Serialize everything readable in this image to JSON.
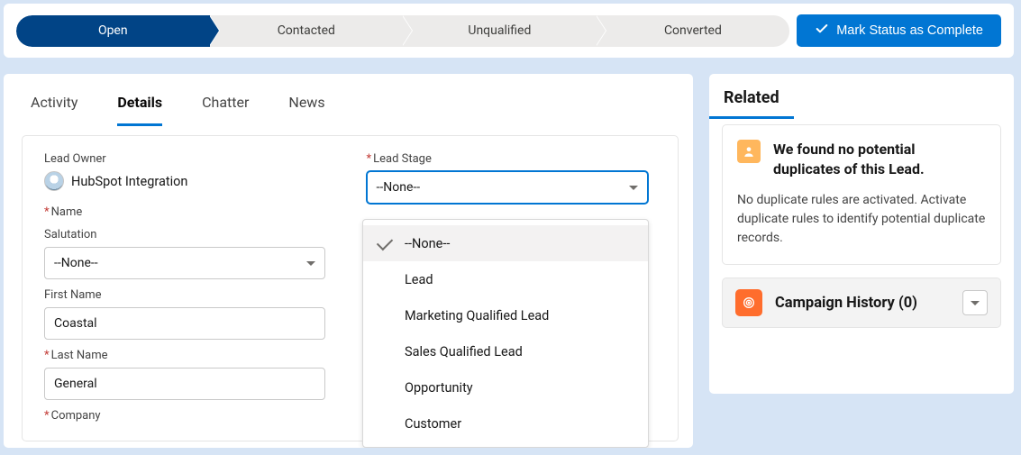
{
  "path": {
    "stages": [
      "Open",
      "Contacted",
      "Unqualified",
      "Converted"
    ],
    "active_index": 0,
    "complete_label": "Mark Status as Complete"
  },
  "tabs": {
    "items": [
      "Activity",
      "Details",
      "Chatter",
      "News"
    ],
    "active_index": 1
  },
  "details": {
    "lead_owner_label": "Lead Owner",
    "lead_owner_value": "HubSpot Integration",
    "name_label": "Name",
    "salutation_label": "Salutation",
    "salutation_value": "--None--",
    "first_name_label": "First Name",
    "first_name_value": "Coastal",
    "last_name_label": "Last Name",
    "last_name_value": "General",
    "company_label": "Company",
    "lead_stage_label": "Lead Stage",
    "lead_stage_value": "--None--",
    "lead_stage_options": [
      "--None--",
      "Lead",
      "Marketing Qualified Lead",
      "Sales Qualified Lead",
      "Opportunity",
      "Customer"
    ],
    "lead_stage_selected_index": 0
  },
  "sidebar": {
    "related_title": "Related",
    "dup_title": "We found no potential duplicates of this Lead.",
    "dup_text": "No duplicate rules are activated. Activate duplicate rules to identify potential duplicate records.",
    "campaign_title": "Campaign History (0)"
  }
}
